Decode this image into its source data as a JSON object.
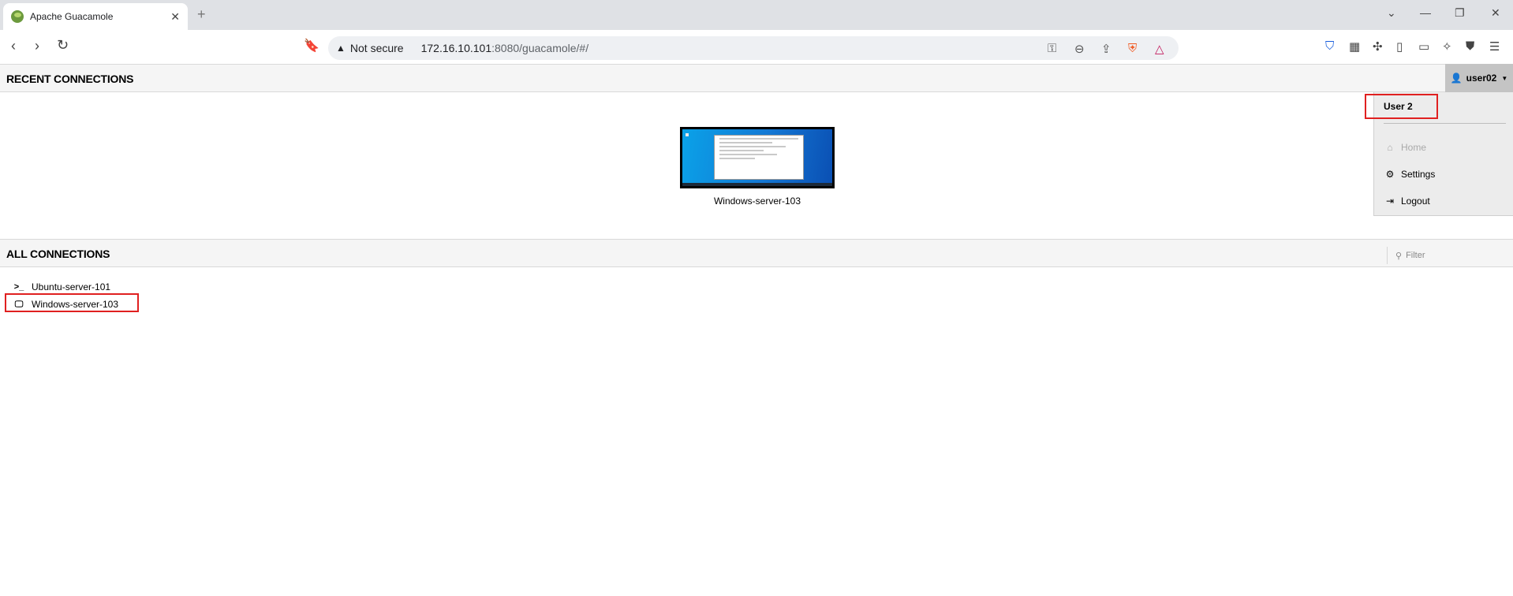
{
  "browser": {
    "tab_title": "Apache Guacamole",
    "tab_close": "✕",
    "new_tab": "+",
    "security_label": "Not secure",
    "url_host": "172.16.10.101",
    "url_path": ":8080/guacamole/#/"
  },
  "sections": {
    "recent": "RECENT CONNECTIONS",
    "all": "ALL CONNECTIONS"
  },
  "user_menu": {
    "username": "user02",
    "display_name": "User 2",
    "items": [
      {
        "label": "Home",
        "icon": "home-icon",
        "enabled": false
      },
      {
        "label": "Settings",
        "icon": "gear-icon",
        "enabled": true
      },
      {
        "label": "Logout",
        "icon": "logout-icon",
        "enabled": true
      }
    ]
  },
  "recent_connections": [
    {
      "name": "Windows-server-103"
    }
  ],
  "filter": {
    "placeholder": "Filter"
  },
  "all_connections": [
    {
      "name": "Ubuntu-server-101",
      "icon": "terminal-icon"
    },
    {
      "name": "Windows-server-103",
      "icon": "monitor-icon"
    }
  ],
  "colors": {
    "highlight": "#e02020",
    "user_button": "#c4c4c4",
    "dropdown_bg": "#ececec"
  }
}
